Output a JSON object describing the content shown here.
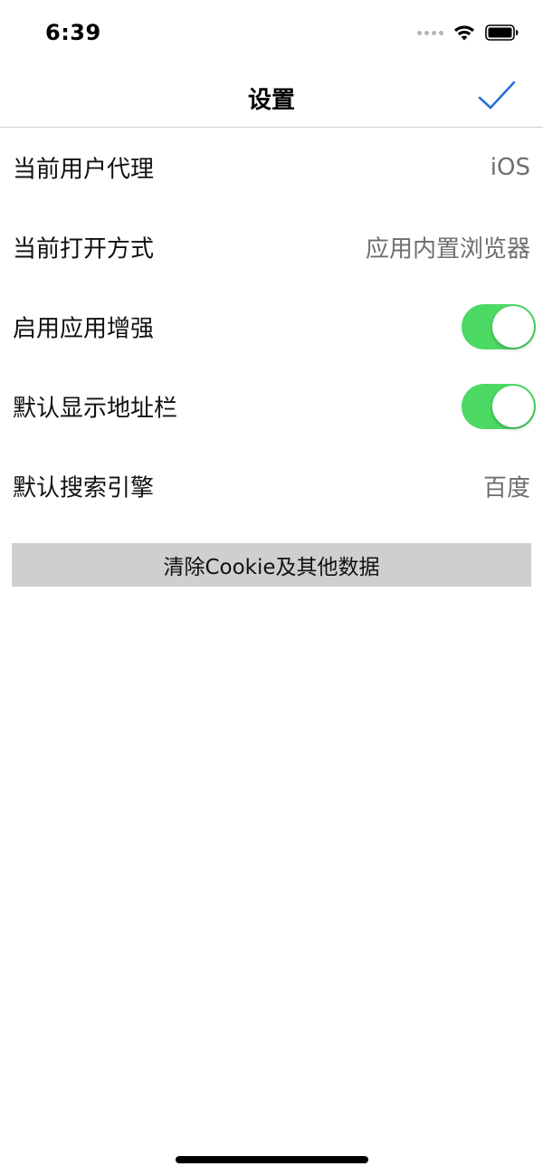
{
  "status_bar": {
    "time": "6:39",
    "icons": [
      "signal-dots-icon",
      "wifi-icon",
      "battery-icon"
    ]
  },
  "nav": {
    "title": "设置",
    "done_icon": "checkmark-icon",
    "accent_color": "#2a6fdb"
  },
  "settings": {
    "rows": [
      {
        "label": "当前用户代理",
        "value": "iOS",
        "type": "value"
      },
      {
        "label": "当前打开方式",
        "value": "应用内置浏览器",
        "type": "value"
      },
      {
        "label": "启用应用增强",
        "type": "toggle",
        "on": true
      },
      {
        "label": "默认显示地址栏",
        "type": "toggle",
        "on": true
      },
      {
        "label": "默认搜索引擎",
        "value": "百度",
        "type": "value"
      }
    ],
    "toggle_on_color": "#4cd964"
  },
  "clear_button": {
    "label": "清除Cookie及其他数据"
  }
}
